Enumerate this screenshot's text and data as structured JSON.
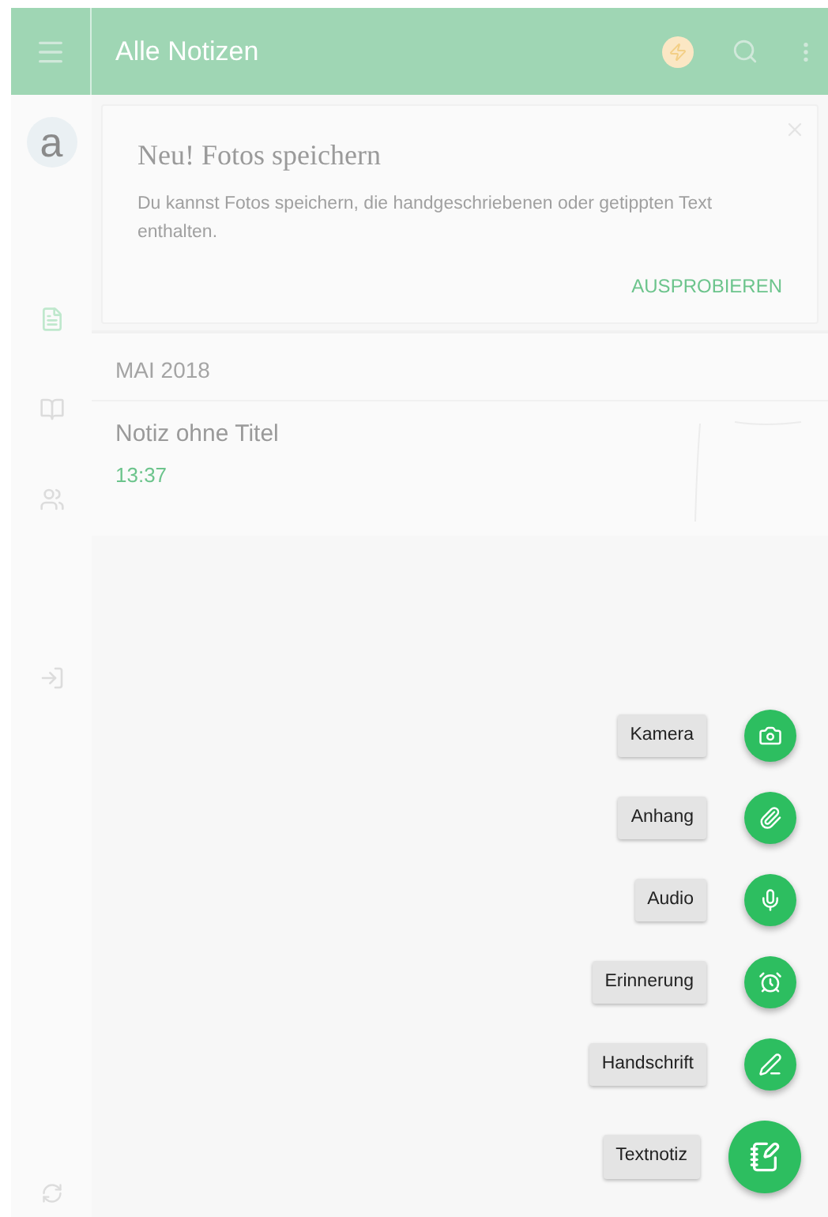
{
  "header": {
    "title": "Alle Notizen"
  },
  "account": {
    "letter": "a"
  },
  "sidebar": {
    "items": [
      {
        "kind": "notes",
        "selected": true
      },
      {
        "kind": "notebooks",
        "selected": false
      },
      {
        "kind": "shared",
        "selected": false
      },
      {
        "kind": "shortcuts",
        "selected": false
      }
    ]
  },
  "promo": {
    "title": "Neu! Fotos speichern",
    "text": "Du kannst Fotos speichern, die handgeschriebenen oder getippten Text enthalten.",
    "action": "AUSPROBIEREN"
  },
  "notes_section": {
    "month": "MAI 2018",
    "notes": [
      {
        "title": "Notiz ohne Titel",
        "time": "13:37",
        "kind": "sketch"
      }
    ]
  },
  "fab_menu": [
    {
      "label": "Kamera",
      "kind": "camera",
      "primary": false
    },
    {
      "label": "Anhang",
      "kind": "attachment",
      "primary": false
    },
    {
      "label": "Audio",
      "kind": "audio",
      "primary": false
    },
    {
      "label": "Erinnerung",
      "kind": "reminder",
      "primary": false
    },
    {
      "label": "Handschrift",
      "kind": "handwriting",
      "primary": false
    },
    {
      "label": "Textnotiz",
      "kind": "text",
      "primary": true
    }
  ]
}
